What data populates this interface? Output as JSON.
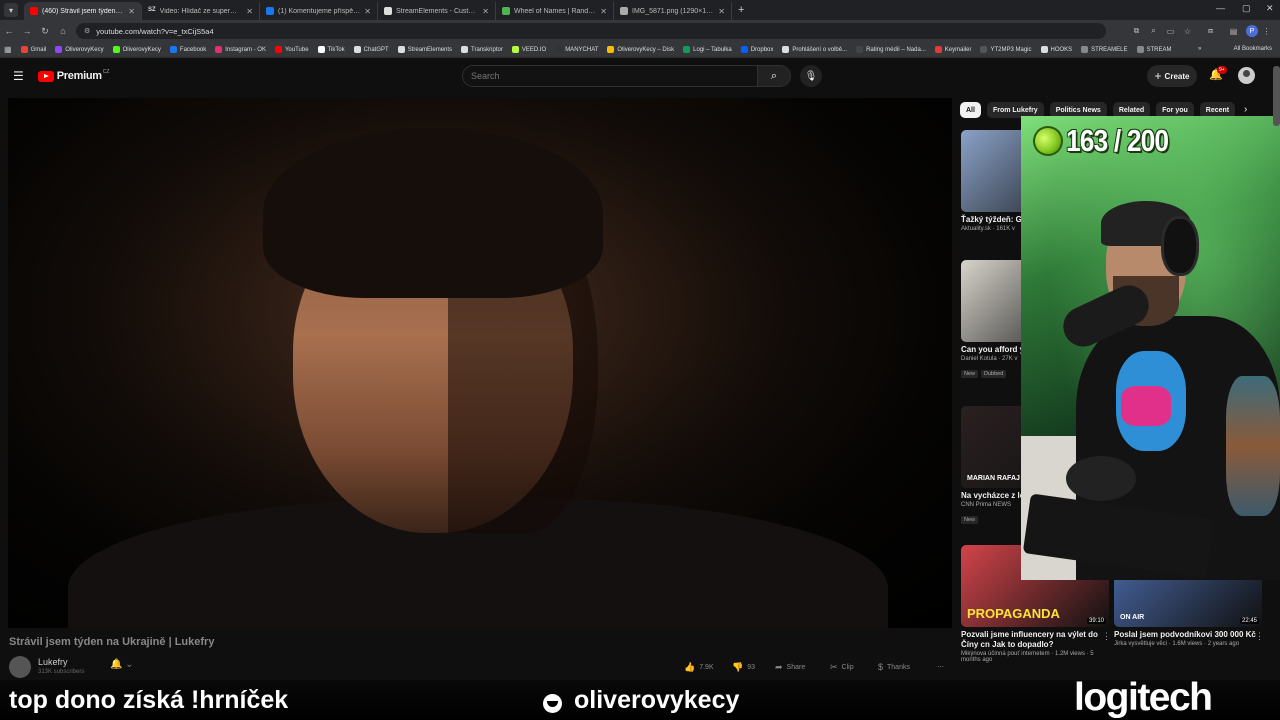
{
  "browser": {
    "tabs": [
      {
        "title": "(460) Strávil jsem týden na Ukr",
        "favicon_color": "#ff0000",
        "active": true
      },
      {
        "title": "Video: Hlídač ze supermarketu",
        "favicon_color": "#cccccc",
        "favicon_text": "SZ",
        "active": false
      },
      {
        "title": "(1) Komentujeme příspěvky de",
        "favicon_color": "#1877f2",
        "active": false
      },
      {
        "title": "StreamElements - Custom com",
        "favicon_color": "#dddddd",
        "active": false
      },
      {
        "title": "Wheel of Names | Random nam",
        "favicon_color": "#4fb34f",
        "active": false
      },
      {
        "title": "IMG_5871.png (1290×1253)",
        "favicon_color": "#aaaaaa",
        "active": false
      }
    ],
    "url": "youtube.com/watch?v=e_txCijS5a4",
    "bookmarks": [
      {
        "label": "Gmail",
        "color": "#ea4335"
      },
      {
        "label": "OliverovyKecy",
        "color": "#9146ff"
      },
      {
        "label": "OliverovyKecy",
        "color": "#53fc18"
      },
      {
        "label": "Facebook",
        "color": "#1877f2"
      },
      {
        "label": "Instagram - OK",
        "color": "#e1306c"
      },
      {
        "label": "YouTube",
        "color": "#ff0000"
      },
      {
        "label": "TikTok",
        "color": "#ffffff"
      },
      {
        "label": "ChatGPT",
        "color": "#dddddd"
      },
      {
        "label": "StreamElements",
        "color": "#dddddd"
      },
      {
        "label": "Transkriptor",
        "color": "#dddddd"
      },
      {
        "label": "VEED.IO",
        "color": "#b5ff3a"
      },
      {
        "label": "MANYCHAT",
        "color": "#333333"
      },
      {
        "label": "OliverovyKecy – Disk",
        "color": "#fbbc04"
      },
      {
        "label": "Logi – Tabulka",
        "color": "#0f9d58"
      },
      {
        "label": "Dropbox",
        "color": "#0061ff"
      },
      {
        "label": "Prohlášení o volbě...",
        "color": "#dddddd"
      },
      {
        "label": "Rating médií – Nada...",
        "color": "#444444"
      },
      {
        "label": "Keymailer",
        "color": "#e53935"
      },
      {
        "label": "YT2MP3 Magic",
        "color": "#555555"
      },
      {
        "label": "HOOKS",
        "color": "#dddddd"
      },
      {
        "label": "STREAMELE",
        "color": "#888888"
      },
      {
        "label": "STREAM",
        "color": "#888888"
      }
    ],
    "all_bookmarks_label": "All Bookmarks",
    "profile_initial": "P"
  },
  "youtube": {
    "logo_text": "Premium",
    "country_code": "CZ",
    "search_placeholder": "Search",
    "create_label": "Create",
    "notif_count": "9+",
    "video": {
      "title": "Strávil jsem týden na Ukrajině | Lukefry",
      "channel": "Lukefry",
      "subscribers": "313K subscribers",
      "likes": "7.9K",
      "comments": "93",
      "share_label": "Share",
      "clip_label": "Clip",
      "thanks_label": "Thanks"
    },
    "chips": [
      "All",
      "From Lukefry",
      "Politics News",
      "Related",
      "For you",
      "Recent"
    ],
    "recommendations": [
      {
        "title": "Ťažký týždeň: Go (5/2026) | Aktuali",
        "meta": "Aktuality.sk · 161K v",
        "thumb": "#8aa2c8",
        "duration": "",
        "badges": []
      },
      {
        "title": "Can you afford yo Prague?",
        "meta": "Daniel Kotula · 27K v",
        "thumb": "#d8d4cc",
        "duration": "",
        "badges": [
          "New",
          "Dubbed"
        ]
      },
      {
        "title": "Na vycházce z léč kamaráda Vilémo",
        "meta": "CNN Prima NEWS",
        "thumb": "#2a2020",
        "thumb_text": "MARIAN RAFAJ",
        "duration": "",
        "badges": [
          "New"
        ]
      },
      {
        "title": "Pozvali jsme influencery na výlet do Číny cn Jak to dopadlo?",
        "meta": "Mikýnova účinná pouť internetem · 1.2M views · 5 months ago",
        "thumb": "#d2444a",
        "thumb_text": "PROPAGANDA",
        "duration": "39:10",
        "badges": []
      },
      {
        "title": "Poslal jsem podvodníkovi 300 000 Kč",
        "meta": "Jirka vysvětluje věci · 1.6M views · 2 years ago",
        "thumb": "#4a6aa8",
        "thumb_text": "ON AIR",
        "duration": "22:45",
        "badges": []
      }
    ]
  },
  "overlay": {
    "counter_text": "163 / 200",
    "donation_text": "top dono získá !hrníček",
    "handle": "oliverovykecy",
    "sponsor": "logitech"
  }
}
